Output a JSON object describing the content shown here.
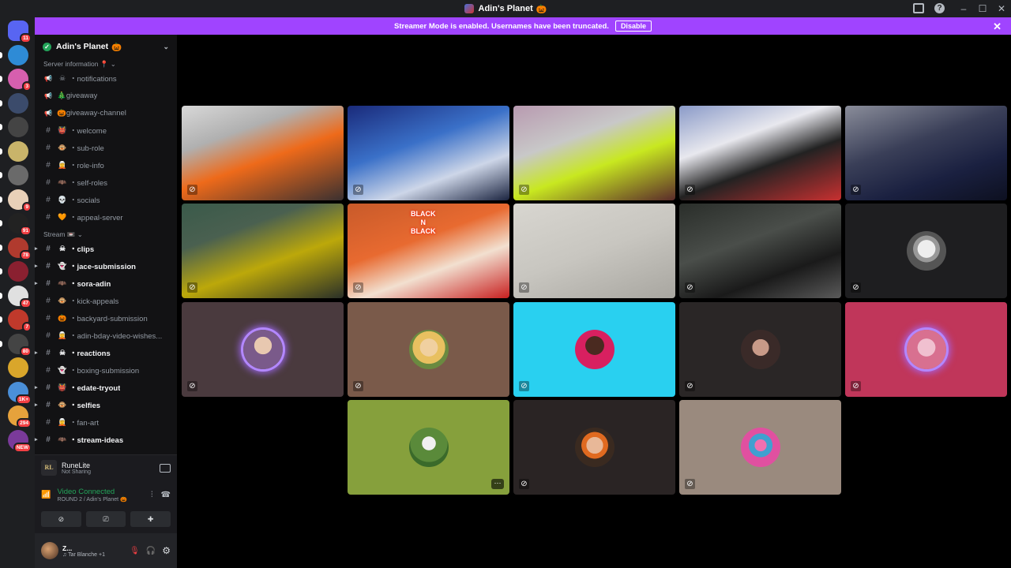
{
  "window": {
    "title": "Adin's Planet",
    "title_emoji": "🎃"
  },
  "banner": {
    "message": "Streamer Mode is enabled. Usernames have been truncated.",
    "disable_label": "Disable",
    "close": "✕"
  },
  "rail": {
    "servers": [
      {
        "badge": "11",
        "color": "#5865f2"
      },
      {
        "badge": "",
        "color": "#2e8bd6"
      },
      {
        "badge": "3",
        "color": "#d65fae"
      },
      {
        "badge": "",
        "color": "#3b4b6b"
      },
      {
        "badge": "",
        "color": "#444"
      },
      {
        "badge": "",
        "color": "#c9b46a"
      },
      {
        "badge": "",
        "color": "#6a6a6a"
      },
      {
        "badge": "9",
        "color": "#e8d0b8"
      },
      {
        "badge": "91",
        "color": "#222"
      },
      {
        "badge": "78",
        "color": "#b03a2e"
      },
      {
        "badge": "",
        "color": "#8a2030"
      },
      {
        "badge": "47",
        "color": "#e0e0e0"
      },
      {
        "badge": "7",
        "color": "#c0392b"
      },
      {
        "badge": "80",
        "color": "#444"
      },
      {
        "badge": "",
        "color": "#d9a62b"
      },
      {
        "badge": "1K+",
        "color": "#4a8fd8"
      },
      {
        "badge": "294",
        "color": "#e6a23c"
      },
      {
        "badge": "NEW",
        "color": "#7a3a9a"
      }
    ]
  },
  "sidebar": {
    "server_name": "Adin's Planet",
    "server_emoji": "🎃",
    "categories": {
      "info": "Server information",
      "stream": "Stream"
    },
    "info_channels": [
      {
        "icon": "megaphone",
        "emoji": "☠",
        "name": "・notifications",
        "unread": false
      },
      {
        "icon": "megaphone",
        "emoji": "",
        "name": "🎄giveaway",
        "unread": false
      },
      {
        "icon": "megaphone",
        "emoji": "",
        "name": "🎃giveaway-channel",
        "unread": false
      },
      {
        "icon": "#",
        "emoji": "👹",
        "name": "・welcome",
        "unread": false
      },
      {
        "icon": "#",
        "emoji": "🐵",
        "name": "・sub-role",
        "unread": false
      },
      {
        "icon": "#",
        "emoji": "🧝",
        "name": "・role-info",
        "unread": false
      },
      {
        "icon": "#",
        "emoji": "🦇",
        "name": "・self-roles",
        "unread": false
      },
      {
        "icon": "#",
        "emoji": "💀",
        "name": "・socials",
        "unread": false
      },
      {
        "icon": "#",
        "emoji": "🧡",
        "name": "・appeal-server",
        "unread": false
      }
    ],
    "stream_channels": [
      {
        "emoji": "☠",
        "name": "・clips",
        "unread": true,
        "arrow": true
      },
      {
        "emoji": "👻",
        "name": "・jace-submission",
        "unread": true,
        "arrow": true
      },
      {
        "emoji": "🦇",
        "name": "・sora-adin",
        "unread": true,
        "arrow": true
      },
      {
        "emoji": "🐵",
        "name": "・kick-appeals",
        "unread": false,
        "arrow": false
      },
      {
        "emoji": "🎃",
        "name": "・backyard-submission",
        "unread": false,
        "arrow": false
      },
      {
        "emoji": "🧝",
        "name": "・adin-bday-video-wishes...",
        "unread": false,
        "arrow": false
      },
      {
        "emoji": "☠",
        "name": "・reactions",
        "unread": true,
        "arrow": true
      },
      {
        "emoji": "👻",
        "name": "・boxing-submission",
        "unread": false,
        "arrow": false
      },
      {
        "emoji": "👹",
        "name": "・edate-tryout",
        "unread": true,
        "arrow": true
      },
      {
        "emoji": "🐵",
        "name": "・selfies",
        "unread": true,
        "arrow": true
      },
      {
        "emoji": "🧝",
        "name": "・fan-art",
        "unread": false,
        "arrow": false
      },
      {
        "emoji": "🦇",
        "name": "・stream-ideas",
        "unread": true,
        "arrow": true
      }
    ]
  },
  "voice": {
    "stream_name": "RuneLite",
    "stream_status": "Not Sharing",
    "rl_logo": "RL",
    "connected_label": "Video Connected",
    "connected_sub": "ROUND 2 / Adin's Planet 🎃",
    "user_name": "Z...",
    "user_status": "♫ Tar Blanche +1"
  },
  "stage": {
    "camera_text": "BLACK\nN\nBLACK",
    "tiles": [
      {
        "kind": "video",
        "bg": "linear-gradient(160deg,#d8d8d8 0%,#b0b0b0 30%,#ee6a1a 55%,#3a3030 100%)"
      },
      {
        "kind": "video",
        "bg": "linear-gradient(160deg,#1a2a7a 0%,#3a70c8 40%,#cdd6e8 70%,#1b2440 100%)"
      },
      {
        "kind": "video",
        "bg": "linear-gradient(160deg,#b89ab0 0%,#c8c8c8 35%,#c8e820 60%,#5a2a2a 100%)"
      },
      {
        "kind": "video",
        "bg": "linear-gradient(160deg,#8a9ac8 0%,#e8e8ee 35%,#222 60%,#c83030 100%)"
      },
      {
        "kind": "video",
        "bg": "linear-gradient(160deg,#8a8d9a 0%,#3a3f58 40%,#1a2040 70%,#0d1020 100%)"
      },
      {
        "kind": "video",
        "bg": "linear-gradient(160deg,#3a5a4a 0%,#4a6050 30%,#bca80a 60%,#2a3028 100%)"
      },
      {
        "kind": "video",
        "bg": "linear-gradient(160deg,#c85a2a 0%,#e86a30 40%,#f2e0d0 65%,#c82020 100%)"
      },
      {
        "kind": "video",
        "bg": "linear-gradient(160deg,#d8d6d0 0%,#c8c6c0 50%,#a8a6a0 100%)"
      },
      {
        "kind": "video",
        "bg": "linear-gradient(160deg,#2a2e2a 0%,#4a4e4a 40%,#1a1a1a 70%,#5a5a5a 100%)"
      },
      {
        "kind": "avatar",
        "bg": "#1e1e20",
        "av": "radial-gradient(circle at 50% 45%,#eee 0 30%,#999 31% 45%,#555 46%)",
        "ring": false
      },
      {
        "kind": "avatar",
        "bg": "#4a3a3e",
        "av": "radial-gradient(circle at 50% 40%,#e8c8b0 0 28%,#7a5a8a 29%)",
        "ring": true
      },
      {
        "kind": "avatar",
        "bg": "#7a5a4a",
        "av": "radial-gradient(circle at 50% 45%,#f0d0a0 0 30%,#e8c060 31% 55%,#6a8a40 56%)",
        "ring": false
      },
      {
        "kind": "avatar",
        "bg": "#29d0f0",
        "av": "radial-gradient(circle at 50% 40%,#4a2a20 0 30%,#d82060 31%)",
        "ring": false
      },
      {
        "kind": "avatar",
        "bg": "#2a2626",
        "av": "radial-gradient(circle at 50% 45%,#c89a88 0 28%,#3a2a28 29%)",
        "ring": false
      },
      {
        "kind": "avatar",
        "bg": "#c0365a",
        "av": "radial-gradient(circle at 50% 45%,#f0c0d0 0 30%,#d87090 31%)",
        "ring": true
      },
      {
        "kind": "avatar",
        "bg": "#86a03c",
        "av": "radial-gradient(circle at 50% 40%,#f0f0f0 0 22%,#5a8a3a 23% 60%,#3a6a2a 61%)",
        "ring": false,
        "more": true
      },
      {
        "kind": "avatar",
        "bg": "#2a2424",
        "av": "radial-gradient(circle at 50% 45%,#e8b898 0 28%,#e06a20 29% 45%,#3a2a20 46%)",
        "ring": false
      },
      {
        "kind": "avatar",
        "bg": "#9a8a7e",
        "av": "radial-gradient(circle at 50% 45%,#f070b0 0 20%,#40a0d0 21% 40%,#e050a0 41%)",
        "ring": false
      }
    ]
  }
}
